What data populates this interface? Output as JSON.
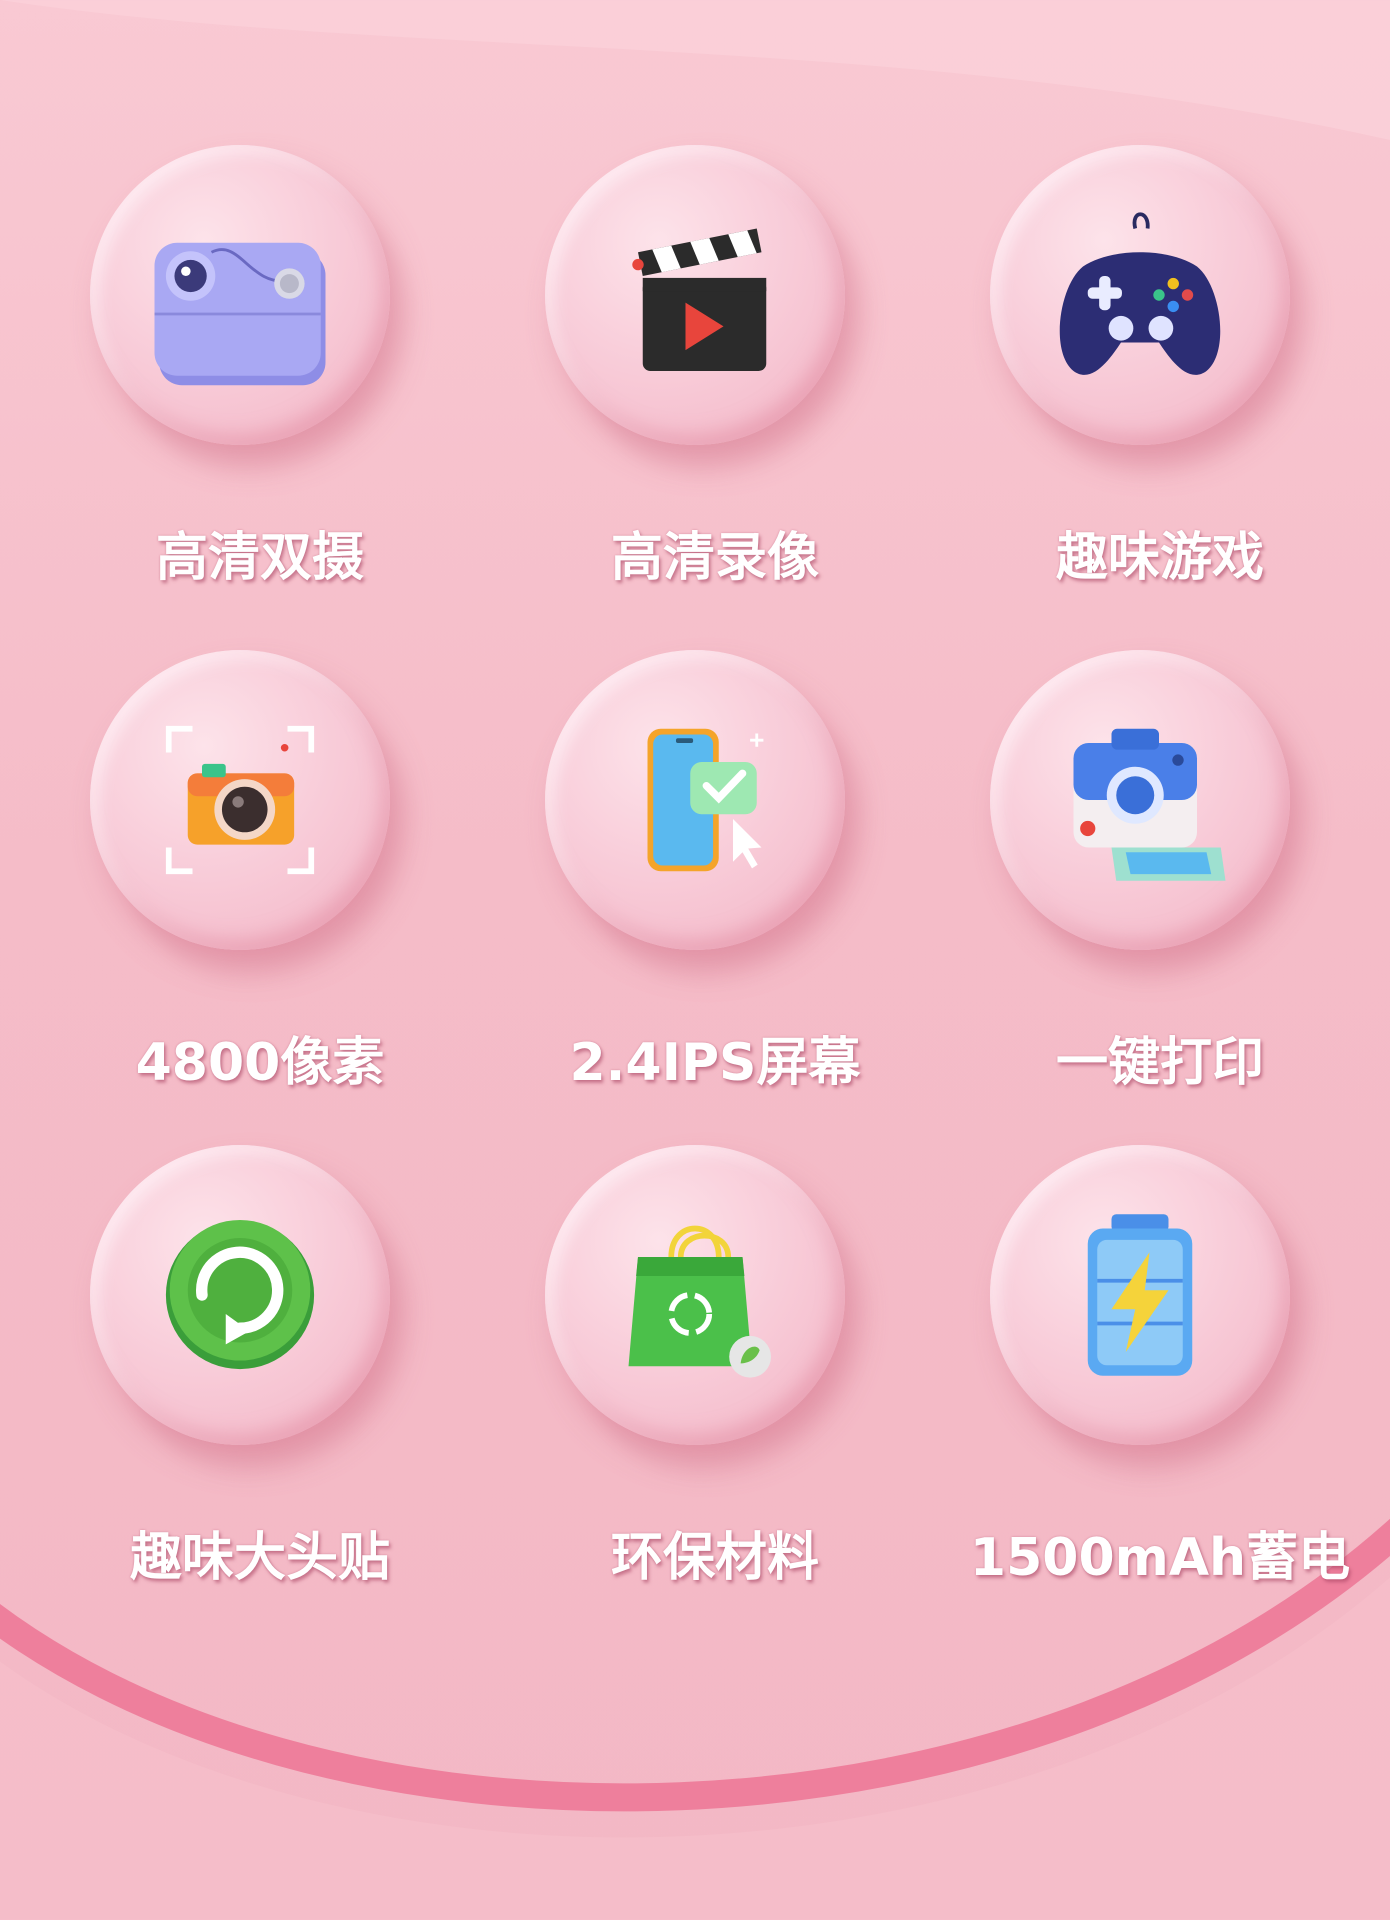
{
  "features": [
    {
      "label": "高清双摄",
      "icon": "dual-camera-icon"
    },
    {
      "label": "高清录像",
      "icon": "clapperboard-icon"
    },
    {
      "label": "趣味游戏",
      "icon": "gamepad-icon"
    },
    {
      "label": "4800像素",
      "icon": "photo-camera-icon"
    },
    {
      "label": "2.4IPS屏幕",
      "icon": "smartphone-icon"
    },
    {
      "label": "一键打印",
      "icon": "instant-print-camera-icon"
    },
    {
      "label": "趣味大头贴",
      "icon": "refresh-sticker-icon"
    },
    {
      "label": "环保材料",
      "icon": "eco-bag-icon"
    },
    {
      "label": "1500mAh蓄电",
      "icon": "battery-icon"
    }
  ],
  "colors": {
    "background": "#f5bcc8",
    "disc": "#f9cfdb",
    "label_text": "#ffffff",
    "accent_line": "#ee7f9c"
  }
}
